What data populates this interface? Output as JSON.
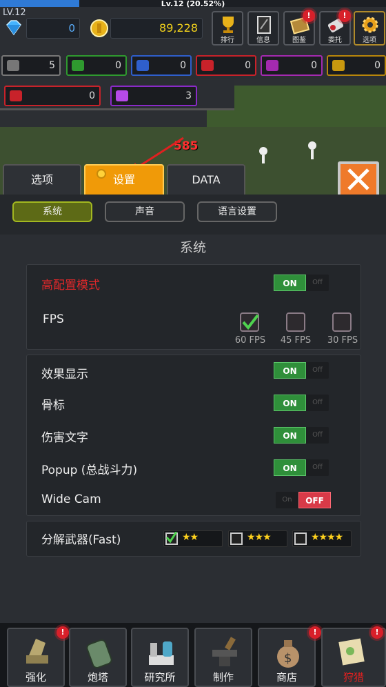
{
  "top": {
    "level_title": "Lv.12 (20.52%)",
    "level_left": "LV.12",
    "xp_fraction": 0.2052,
    "gems": "0",
    "gold": "89,228"
  },
  "menu": [
    {
      "label": "排行",
      "icon": "trophy-icon",
      "badge": ""
    },
    {
      "label": "信息",
      "icon": "book-icon",
      "badge": ""
    },
    {
      "label": "图鉴",
      "icon": "codex-icon",
      "badge": "!"
    },
    {
      "label": "委托",
      "icon": "quest-scroll-icon",
      "badge": "!"
    },
    {
      "label": "选项",
      "icon": "gear-icon",
      "badge": ""
    }
  ],
  "resources": [
    {
      "value": "5",
      "color": "#777777",
      "icon": "gray-ore-icon"
    },
    {
      "value": "0",
      "color": "#2f9a2f",
      "icon": "green-ore-icon"
    },
    {
      "value": "0",
      "color": "#2f5fcc",
      "icon": "blue-ore-icon"
    },
    {
      "value": "0",
      "color": "#c8222a",
      "icon": "red-ore-icon"
    },
    {
      "value": "0",
      "color": "#a42ab0",
      "icon": "purple-ore-icon"
    },
    {
      "value": "0",
      "color": "#b8860b",
      "icon": "gold-ore-icon"
    }
  ],
  "gems2": [
    {
      "value": "0",
      "color": "#c8222a",
      "icon": "ruby-icon"
    },
    {
      "value": "3",
      "color": "#8a2ac8",
      "icon": "amethyst-icon"
    }
  ],
  "scene": {
    "damage_text": "585"
  },
  "tabs": [
    {
      "label": "选项"
    },
    {
      "label": "设置"
    },
    {
      "label": "DATA"
    }
  ],
  "subtabs": [
    {
      "label": "系统"
    },
    {
      "label": "声音"
    },
    {
      "label": "语言设置"
    }
  ],
  "section_title": "系统",
  "high_quality": {
    "label": "高配置模式",
    "on": "ON",
    "off": "Off"
  },
  "fps": {
    "label": "FPS",
    "options": [
      "60 FPS",
      "45 FPS",
      "30 FPS"
    ],
    "selected": "60 FPS"
  },
  "settings": [
    {
      "label": "效果显示",
      "on": "ON",
      "off": "Off"
    },
    {
      "label": "骨标",
      "on": "ON",
      "off": "Off"
    },
    {
      "label": "伤害文字",
      "on": "ON",
      "off": "Off"
    },
    {
      "label": "Popup (总战斗力)",
      "on": "ON",
      "off": "Off"
    }
  ],
  "widecam": {
    "label": "Wide Cam",
    "on": "On",
    "off": "OFF"
  },
  "dismantle": {
    "label": "分解武器(Fast)",
    "options": [
      "★★",
      "★★★",
      "★★★★"
    ],
    "checked": [
      true,
      false,
      false
    ]
  },
  "nav": [
    {
      "label": "强化",
      "icon": "anvil-claw-icon",
      "badge": "!"
    },
    {
      "label": "炮塔",
      "icon": "turret-icon",
      "badge": ""
    },
    {
      "label": "研究所",
      "icon": "lab-icon",
      "badge": ""
    },
    {
      "label": "制作",
      "icon": "crafting-anvil-icon",
      "badge": ""
    },
    {
      "label": "商店",
      "icon": "money-bag-icon",
      "badge": "!"
    },
    {
      "label": "狩猎",
      "icon": "map-icon",
      "badge": "!"
    }
  ],
  "colors": {
    "accent_orange": "#f09a08",
    "on_green": "#2f8f3a",
    "off_red": "#d83a48",
    "alert_red": "#d8202a"
  }
}
